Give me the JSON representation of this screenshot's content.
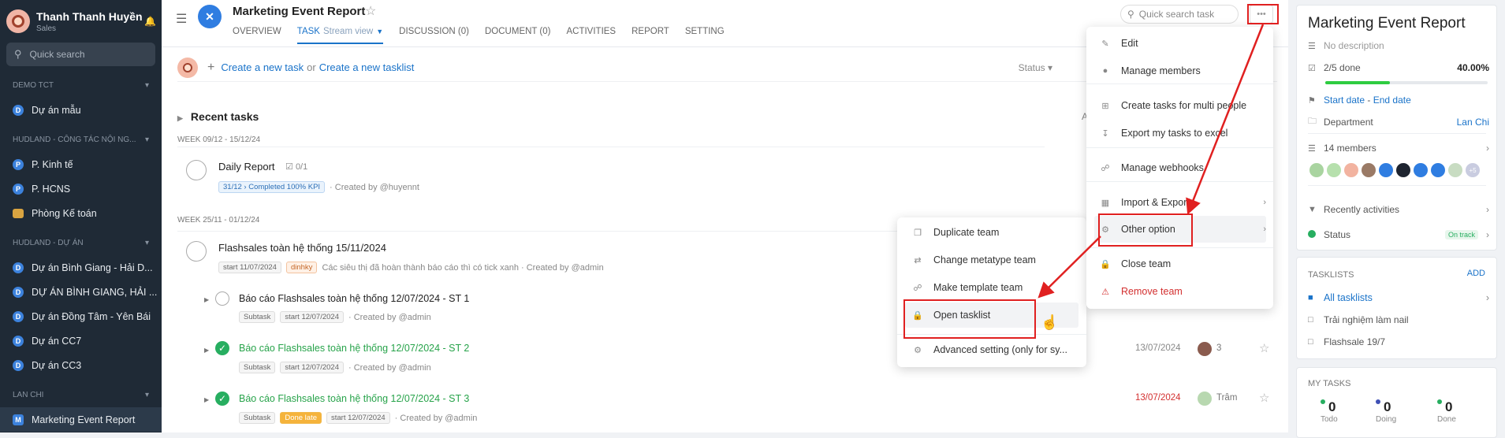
{
  "sidebar": {
    "user_name": "Thanh Thanh Huyền",
    "user_role": "Sales",
    "search_placeholder": "Quick search",
    "groups": [
      {
        "label": "DEMO TCT",
        "items": [
          {
            "letter": "D",
            "label": "Dự án mẫu"
          }
        ]
      },
      {
        "label": "HUDLAND - CÔNG TÁC NỘI NG...",
        "items": [
          {
            "letter": "P",
            "label": "P. Kinh tế"
          },
          {
            "letter": "P",
            "label": "P. HCNS"
          },
          {
            "letter": "",
            "label": "Phòng Kế toán"
          }
        ]
      },
      {
        "label": "HUDLAND - DỰ ÁN",
        "items": [
          {
            "letter": "D",
            "label": "Dự án Bình Giang - Hải D..."
          },
          {
            "letter": "D",
            "label": "DỰ ÁN BÌNH GIANG, HẢI ..."
          },
          {
            "letter": "D",
            "label": "Dự án Đồng Tâm - Yên Bái"
          },
          {
            "letter": "D",
            "label": "Dự án CC7"
          },
          {
            "letter": "D",
            "label": "Dự án CC3"
          }
        ]
      },
      {
        "label": "LAN CHI",
        "items": [
          {
            "letter": "M",
            "label": "Marketing Event Report"
          }
        ]
      }
    ]
  },
  "header": {
    "logo_letter": "✕",
    "title": "Marketing Event Report",
    "tabs": [
      "OVERVIEW",
      "TASK",
      "DISCUSSION (0)",
      "DOCUMENT (0)",
      "ACTIVITIES",
      "REPORT",
      "SETTING"
    ],
    "task_view": "Stream view",
    "search_placeholder": "Quick search task",
    "more": "•••"
  },
  "create": {
    "task_link": "Create a new task",
    "or": "or",
    "tasklist_link": "Create a new tasklist",
    "status_filter": "Status"
  },
  "recent": {
    "title": "Recent tasks",
    "cut": "A"
  },
  "weeks": [
    "WEEK 09/12 - 15/12/24",
    "WEEK 25/11 - 01/12/24"
  ],
  "tasks": {
    "t1": {
      "title": "Daily Report",
      "check": "0/1",
      "badge": "31/12 › Completed 100% KPI",
      "created": "· Created by @huyennt"
    },
    "t2": {
      "title": "Flashsales toàn hệ thống 15/11/2024",
      "start": "start 11/07/2024",
      "tag": "dinhky",
      "note": "Các siêu thị đã hoàn thành báo cáo thì có tick xanh · Created by @admin"
    },
    "s1": {
      "title": "Báo cáo Flashsales toàn hệ thống 12/07/2024 - ST 1",
      "sub": "Subtask",
      "start": "start 12/07/2024",
      "created": "· Created by @admin"
    },
    "s2": {
      "title": "Báo cáo Flashsales toàn hệ thống 12/07/2024 - ST 2",
      "sub": "Subtask",
      "start": "start 12/07/2024",
      "created": "· Created by @admin",
      "date": "13/07/2024",
      "count": "3"
    },
    "s3": {
      "title": "Báo cáo Flashsales toàn hệ thống 12/07/2024 - ST 3",
      "sub": "Subtask",
      "late": "Done late",
      "start": "start 12/07/2024",
      "created": "· Created by @admin",
      "date": "13/07/2024",
      "person": "Trâm"
    }
  },
  "main_menu": {
    "edit": "Edit",
    "members": "Manage members",
    "multi": "Create tasks for multi people",
    "export": "Export my tasks to excel",
    "webhooks": "Manage webhooks",
    "import": "Import & Export",
    "other": "Other option",
    "close": "Close team",
    "remove": "Remove team"
  },
  "sub_menu": {
    "duplicate": "Duplicate team",
    "metatype": "Change metatype team",
    "template": "Make template team",
    "open": "Open tasklist",
    "advanced": "Advanced setting (only for sy..."
  },
  "panel": {
    "title": "Marketing Event Report",
    "desc": "No description",
    "done": "2/5 done",
    "percent": "40.00%",
    "progress": 0.4,
    "start": "Start date",
    "dash": "-",
    "end": "End date",
    "dept_label": "Department",
    "dept_value": "Lan Chi",
    "members": "14 members",
    "more_members": "+5",
    "activities": "Recently activities",
    "status_label": "Status",
    "status_value": "On track",
    "tasklists_title": "TASKLISTS",
    "add": "ADD",
    "tasklists": [
      "All tasklists",
      "Trải nghiệm làm nail",
      "Flashsale 19/7"
    ],
    "mytasks_title": "MY TASKS",
    "mytasks": [
      {
        "n": "0",
        "label": "Todo"
      },
      {
        "n": "0",
        "label": "Doing"
      },
      {
        "n": "0",
        "label": "Done"
      }
    ]
  },
  "colors": {
    "accent": "#1a73c9",
    "highlight": "#e02020",
    "success": "#27ae60",
    "sidebar": "#1f2a36"
  }
}
